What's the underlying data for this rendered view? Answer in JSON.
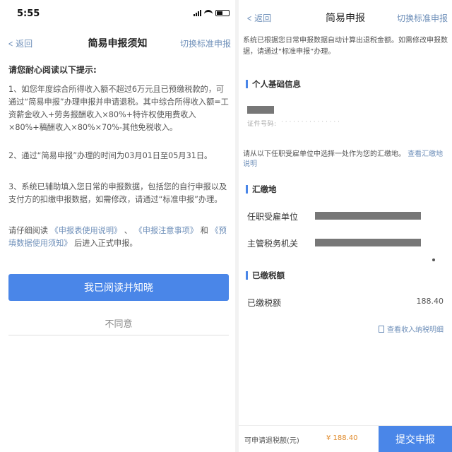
{
  "left": {
    "status": {
      "time": "5:55"
    },
    "nav": {
      "back": "返回",
      "title": "简易申报须知",
      "switch": "切换标准申报"
    },
    "prompt_head": "请您耐心阅读以下提示:",
    "para1": "1、如您年度综合所得收入额不超过6万元且已预缴税款的，可通过“简易申报”办理申报并申请退税。其中综合所得收入额=工资薪金收入+劳务报酬收入×80%+特许权使用费收入×80%+稿酬收入×80%×70%-其他免税收入。",
    "para2": "2、通过“简易申报”办理的时间为03月01日至05月31日。",
    "para3": "3、系统已辅助填入您日常的申报数据，包括您的自行申报以及支付方的扣缴申报数据，如需修改，请通过“标准申报”办理。",
    "para4": {
      "pre": "请仔细阅读",
      "link1": "《申报表使用说明》",
      "sep": "、",
      "link2": "《申报注意事项》",
      "and": "和",
      "link3": "《预填数据使用须知》",
      "post": "后进入正式申报。"
    },
    "agree_button": "我已阅读并知晓",
    "disagree": "不同意"
  },
  "right": {
    "nav": {
      "back": "返回",
      "title": "简易申报",
      "switch": "切换标准申报"
    },
    "notice": "系统已根据您日常申报数据自动计算出退税金额。如需修改申报数据，请通过“标准申报”办理。",
    "section1": "个人基础信息",
    "id_label": "证件号码:",
    "hint_text": "请从以下任职受雇单位中选择一处作为您的汇缴地。",
    "hint_link": "查看汇缴地说明",
    "section2": "汇缴地",
    "employer_label": "任职受雇单位",
    "tax_office_label": "主管税务机关",
    "section3": "已缴税额",
    "paid_label": "已缴税额",
    "paid_value": "188.40",
    "detail_link": "查看收入纳税明细",
    "refund_label": "可申请退税额(元)",
    "refund_amount": "¥ 188.40",
    "submit": "提交申报"
  },
  "colors": {
    "accent": "#4a86e8",
    "link": "#6e8fb9",
    "amount": "#e08a2a"
  }
}
